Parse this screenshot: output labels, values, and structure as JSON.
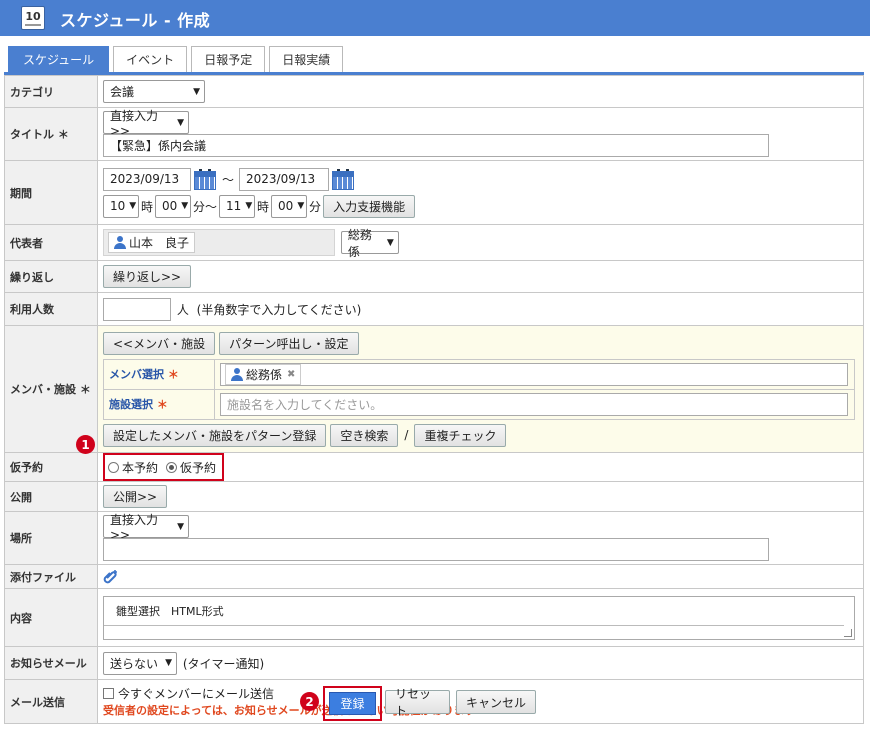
{
  "header": {
    "icon_day": "10",
    "title": "スケジュール - 作成"
  },
  "tabs": [
    {
      "label": "スケジュール",
      "active": true
    },
    {
      "label": "イベント"
    },
    {
      "label": "日報予定"
    },
    {
      "label": "日報実績"
    }
  ],
  "form": {
    "category": {
      "label": "カテゴリ",
      "value": "会議"
    },
    "title": {
      "label": "タイトル",
      "star": "＊",
      "mode": "直接入力>>",
      "value": "【緊急】係内会議"
    },
    "period": {
      "label": "期間",
      "start_date": "2023/09/13",
      "end_date": "2023/09/13",
      "tilde": "～",
      "start_hour": "10",
      "start_min": "00",
      "end_hour": "11",
      "end_min": "00",
      "ji": "時",
      "fun_tilde": "分～",
      "fun": "分",
      "assist_button": "入力支援機能"
    },
    "representative": {
      "label": "代表者",
      "name": "山本　良子",
      "dept": "総務係"
    },
    "repeat": {
      "label": "繰り返し",
      "button": "繰り返し>>"
    },
    "users": {
      "label": "利用人数",
      "unit": "人",
      "hint": "(半角数字で入力してください)"
    },
    "members": {
      "label": "メンバ・施設",
      "star": "＊",
      "btn_members": "<<メンバ・施設",
      "btn_pattern": "パターン呼出し・設定",
      "member_select_label": "メンバ選択",
      "member_chip": "総務係",
      "facility_select_label": "施設選択",
      "facility_placeholder": "施設名を入力してください。",
      "btn_register_pattern": "設定したメンバ・施設をパターン登録",
      "btn_vacancy": "空き検索",
      "slash": "/",
      "btn_duplicate": "重複チェック"
    },
    "tentative": {
      "label": "仮予約",
      "opt1": "本予約",
      "opt2": "仮予約",
      "selected": "仮予約"
    },
    "publish": {
      "label": "公開",
      "button": "公開>>"
    },
    "place": {
      "label": "場所",
      "mode": "直接入力>>"
    },
    "attachment": {
      "label": "添付ファイル"
    },
    "content": {
      "label": "内容",
      "toolbar": "雛型選択　HTML形式"
    },
    "notify_mail": {
      "label": "お知らせメール",
      "value": "送らない",
      "hint": "(タイマー通知)"
    },
    "mail_send": {
      "label": "メール送信",
      "checkbox_label": "今すぐメンバーにメール送信",
      "warning": "受信者の設定によっては、お知らせメールが送信されない可能性があります"
    }
  },
  "annotations": {
    "badge1": "1",
    "badge2": "2"
  },
  "footer": {
    "register": "登録",
    "reset": "リセット",
    "cancel": "キャンセル"
  },
  "colors": {
    "accent": "#4a7fd0",
    "required": "#e0481f",
    "highlight": "#d0021b"
  }
}
